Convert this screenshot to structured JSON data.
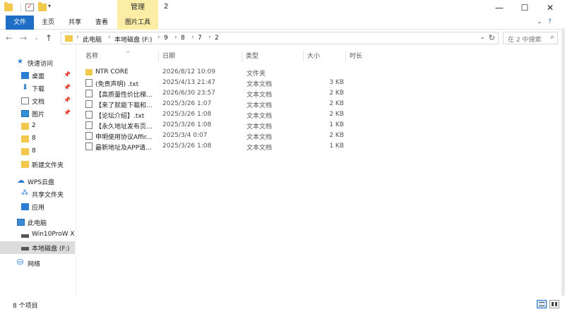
{
  "window": {
    "title": "2",
    "manage_tab": "管理",
    "minimize": "—",
    "maximize": "☐",
    "close": "✕"
  },
  "ribbon": {
    "tabs": [
      "文件",
      "主页",
      "共享",
      "查看",
      "图片工具"
    ],
    "expand_icon": "chevron-down-icon",
    "help_icon": "help-icon"
  },
  "address": {
    "crumbs": [
      "此电脑",
      "本地磁盘 (F:)",
      "9",
      "8",
      "7",
      "2"
    ],
    "search_placeholder": "在 2 中搜索"
  },
  "nav": {
    "quick_access": "快速访问",
    "items": [
      {
        "label": "桌面",
        "pinned": true
      },
      {
        "label": "下载",
        "pinned": true
      },
      {
        "label": "文档",
        "pinned": true
      },
      {
        "label": "图片",
        "pinned": true
      },
      {
        "label": "2"
      },
      {
        "label": "8"
      },
      {
        "label": "8"
      },
      {
        "label": "新建文件夹"
      }
    ],
    "wps": "WPS云盘",
    "wps_items": [
      "共享文件夹",
      "应用"
    ],
    "this_pc": "此电脑",
    "pc_items": [
      "Win10ProW X",
      "本地磁盘 (F:)"
    ],
    "network": "网络"
  },
  "columns": {
    "name": "名称",
    "date": "日期",
    "type": "类型",
    "size": "大小",
    "duration": "时长"
  },
  "files": [
    {
      "name": "NTR CORE",
      "date": "2026/8/12 10:09",
      "type": "文件夹",
      "size": "",
      "kind": "folder"
    },
    {
      "name": "(免责声明) .txt",
      "date": "2025/4/13 21:47",
      "type": "文本文档",
      "size": "3 KB",
      "kind": "txt"
    },
    {
      "name": "【高质量性价比梯...",
      "date": "2026/6/30 23:57",
      "type": "文本文档",
      "size": "2 KB",
      "kind": "txt"
    },
    {
      "name": "【来了就能下载和...",
      "date": "2025/3/26 1:07",
      "type": "文本文档",
      "size": "2 KB",
      "kind": "txt"
    },
    {
      "name": "【论坛介绍】.txt",
      "date": "2025/3/26 1:08",
      "type": "文本文档",
      "size": "2 KB",
      "kind": "txt"
    },
    {
      "name": "【永久地址发布页...",
      "date": "2025/3/26 1:08",
      "type": "文本文档",
      "size": "1 KB",
      "kind": "txt"
    },
    {
      "name": "申明使用协议Affir...",
      "date": "2025/3/4 0:07",
      "type": "文本文档",
      "size": "2 KB",
      "kind": "txt"
    },
    {
      "name": "最新地址及APP请...",
      "date": "2025/3/26 1:08",
      "type": "文本文档",
      "size": "1 KB",
      "kind": "txt"
    }
  ],
  "status": {
    "count": "8 个项目"
  }
}
